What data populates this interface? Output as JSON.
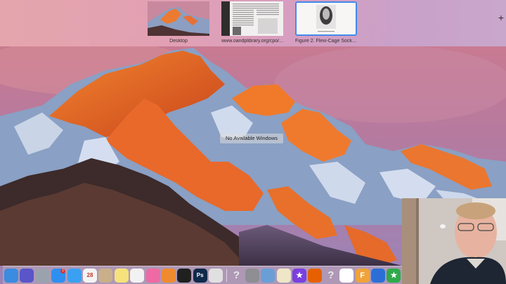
{
  "spaces": [
    {
      "label": "Desktop"
    },
    {
      "label": "www.oandplibrary.org/cpo/..."
    },
    {
      "label": "Figure 2. Flexi-Cage Socke..."
    }
  ],
  "message": "No Available Windows",
  "add_space_glyph": "+",
  "dock": {
    "items": [
      {
        "name": "finder-icon",
        "color": "#3b8be0"
      },
      {
        "name": "siri-icon",
        "color": "#5a55c8"
      },
      {
        "name": "launchpad-icon",
        "color": "#9aa3ad"
      },
      {
        "name": "app-store-icon",
        "color": "#2f8ff0",
        "badge": "1"
      },
      {
        "name": "safari-icon",
        "color": "#3aa0f2"
      },
      {
        "name": "calendar-icon",
        "color": "#f4f4f4",
        "text": "28"
      },
      {
        "name": "contacts-icon",
        "color": "#c9b08a"
      },
      {
        "name": "notes-icon",
        "color": "#f6e27a"
      },
      {
        "name": "photos-icon",
        "color": "#f2f2f2"
      },
      {
        "name": "itunes-icon",
        "color": "#ef6aa4"
      },
      {
        "name": "ibooks-icon",
        "color": "#f08a2e"
      },
      {
        "name": "system-monitor-icon",
        "color": "#202020"
      },
      {
        "name": "photoshop-icon",
        "color": "#0f2a4a",
        "text": "Ps"
      },
      {
        "name": "color-wheel-icon",
        "color": "#e0e0e0"
      },
      {
        "name": "unknown-app-icon",
        "color": "transparent",
        "text": "?"
      },
      {
        "name": "system-preferences-icon",
        "color": "#8e8e93"
      },
      {
        "name": "preview-icon",
        "color": "#6a9fd6"
      },
      {
        "name": "textedit-icon",
        "color": "#efe6c8"
      },
      {
        "name": "imovie-icon",
        "color": "#7b3fe0",
        "text": "★"
      },
      {
        "name": "firefox-icon",
        "color": "#e66000"
      },
      {
        "name": "help-icon",
        "color": "transparent",
        "text": "?"
      },
      {
        "name": "document-icon",
        "color": "#ffffff"
      },
      {
        "name": "illustrator-icon",
        "color": "#f0a33a",
        "text": "F"
      },
      {
        "name": "sync-app-icon",
        "color": "#2b6fd6"
      },
      {
        "name": "green-star-icon",
        "color": "#2faa4a",
        "text": "★"
      },
      {
        "name": "red-app-icon",
        "color": "#d6332b"
      }
    ]
  },
  "colors": {
    "selected_space_border": "#3d8bf0",
    "spaces_bar_left": "#e6a7ad",
    "spaces_bar_right": "#c9a8cf"
  }
}
